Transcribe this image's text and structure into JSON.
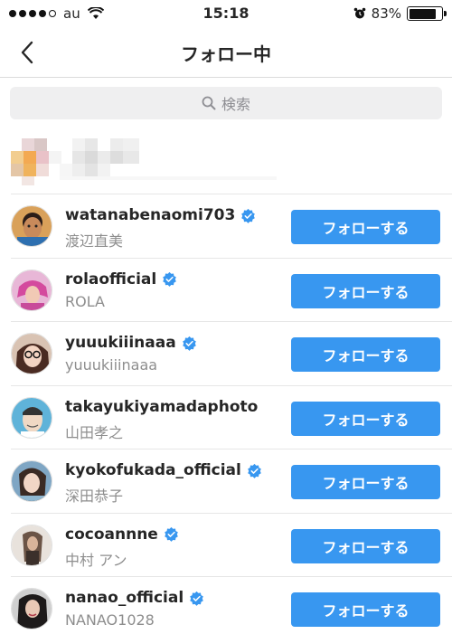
{
  "status_bar": {
    "carrier": "au",
    "time": "15:18",
    "battery": "83%",
    "battery_level": 0.83
  },
  "nav": {
    "title": "フォロー中"
  },
  "search": {
    "placeholder": "検索"
  },
  "accounts": [
    {
      "username": "watanabenaomi703",
      "full_name": "渡辺直美",
      "verified": true,
      "button": "フォローする"
    },
    {
      "username": "rolaofficial",
      "full_name": "ROLA",
      "verified": true,
      "button": "フォローする"
    },
    {
      "username": "yuuukiiinaaa",
      "full_name": "yuuukiiinaaa",
      "verified": true,
      "button": "フォローする"
    },
    {
      "username": "takayukiyamadaphoto",
      "full_name": "山田孝之",
      "verified": false,
      "button": "フォローする"
    },
    {
      "username": "kyokofukada_official",
      "full_name": "深田恭子",
      "verified": true,
      "button": "フォローする"
    },
    {
      "username": "cocoannne",
      "full_name": "中村 アン",
      "verified": true,
      "button": "フォローする"
    },
    {
      "username": "nanao_official",
      "full_name": "NANAO1028",
      "verified": true,
      "button": "フォローする"
    }
  ],
  "colors": {
    "accent": "#3897f0",
    "verified": "#3897f0"
  }
}
